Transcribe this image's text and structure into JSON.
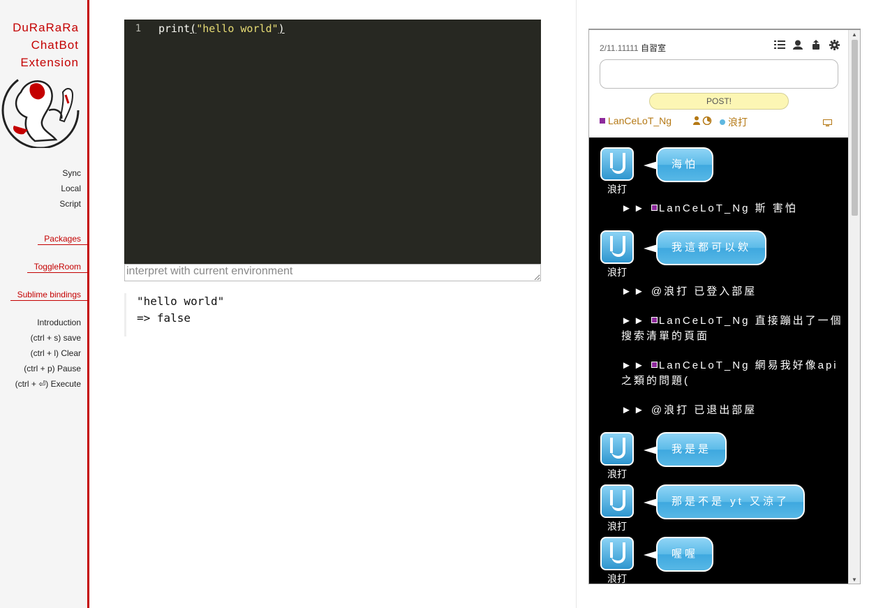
{
  "sidebar": {
    "brand_line1": "DuRaRaRa",
    "brand_line2": "ChatBot",
    "brand_line3": "Extension",
    "links": {
      "sync": "Sync",
      "local": "Local",
      "script": "Script",
      "packages": "Packages",
      "toggleroom": "ToggleRoom",
      "sublime": "Sublime bindings",
      "introduction": "Introduction",
      "save": "(ctrl + s) save",
      "clear": "(ctrl + l) Clear",
      "pause": "(ctrl + p) Pause",
      "execute": "(ctrl + ⏎) Execute"
    },
    "accent_color": "#c40000"
  },
  "editor": {
    "line_number": "1",
    "code_fn": "print",
    "code_open": "(",
    "code_string": "\"hello world\"",
    "code_close": ")",
    "interpret_placeholder": "interpret with current environment"
  },
  "output": {
    "line1": "\"hello world\"",
    "line2": "=> false"
  },
  "chat": {
    "room_count": "2/11.11111",
    "room_name": "自習室",
    "post_label": "POST!",
    "members": {
      "member1": "LanCeLoT_Ng",
      "member2": "浪打"
    },
    "icons": [
      "list-icon",
      "user-icon",
      "share-icon",
      "gear-icon",
      "tv-icon"
    ],
    "messages": [
      {
        "user": "浪打",
        "text": "海怕"
      },
      {
        "system": "►► ",
        "name": "LanCeLoT_Ng",
        "text": " 斯 害怕"
      },
      {
        "user": "浪打",
        "text": "我這都可以欸"
      },
      {
        "system": "►► @浪打 已登入部屋"
      },
      {
        "system": "►► ",
        "name": "LanCeLoT_Ng",
        "text": " 直接蹦出了一個搜索清單的頁面"
      },
      {
        "system": "►► ",
        "name": "LanCeLoT_Ng",
        "text": " 網易我好像api之類的問題("
      },
      {
        "system": "►► @浪打 已退出部屋"
      },
      {
        "user": "浪打",
        "text": "我是是"
      },
      {
        "user": "浪打",
        "text": "那是不是 yt 又涼了"
      },
      {
        "user": "浪打",
        "text": "喔喔"
      }
    ]
  }
}
